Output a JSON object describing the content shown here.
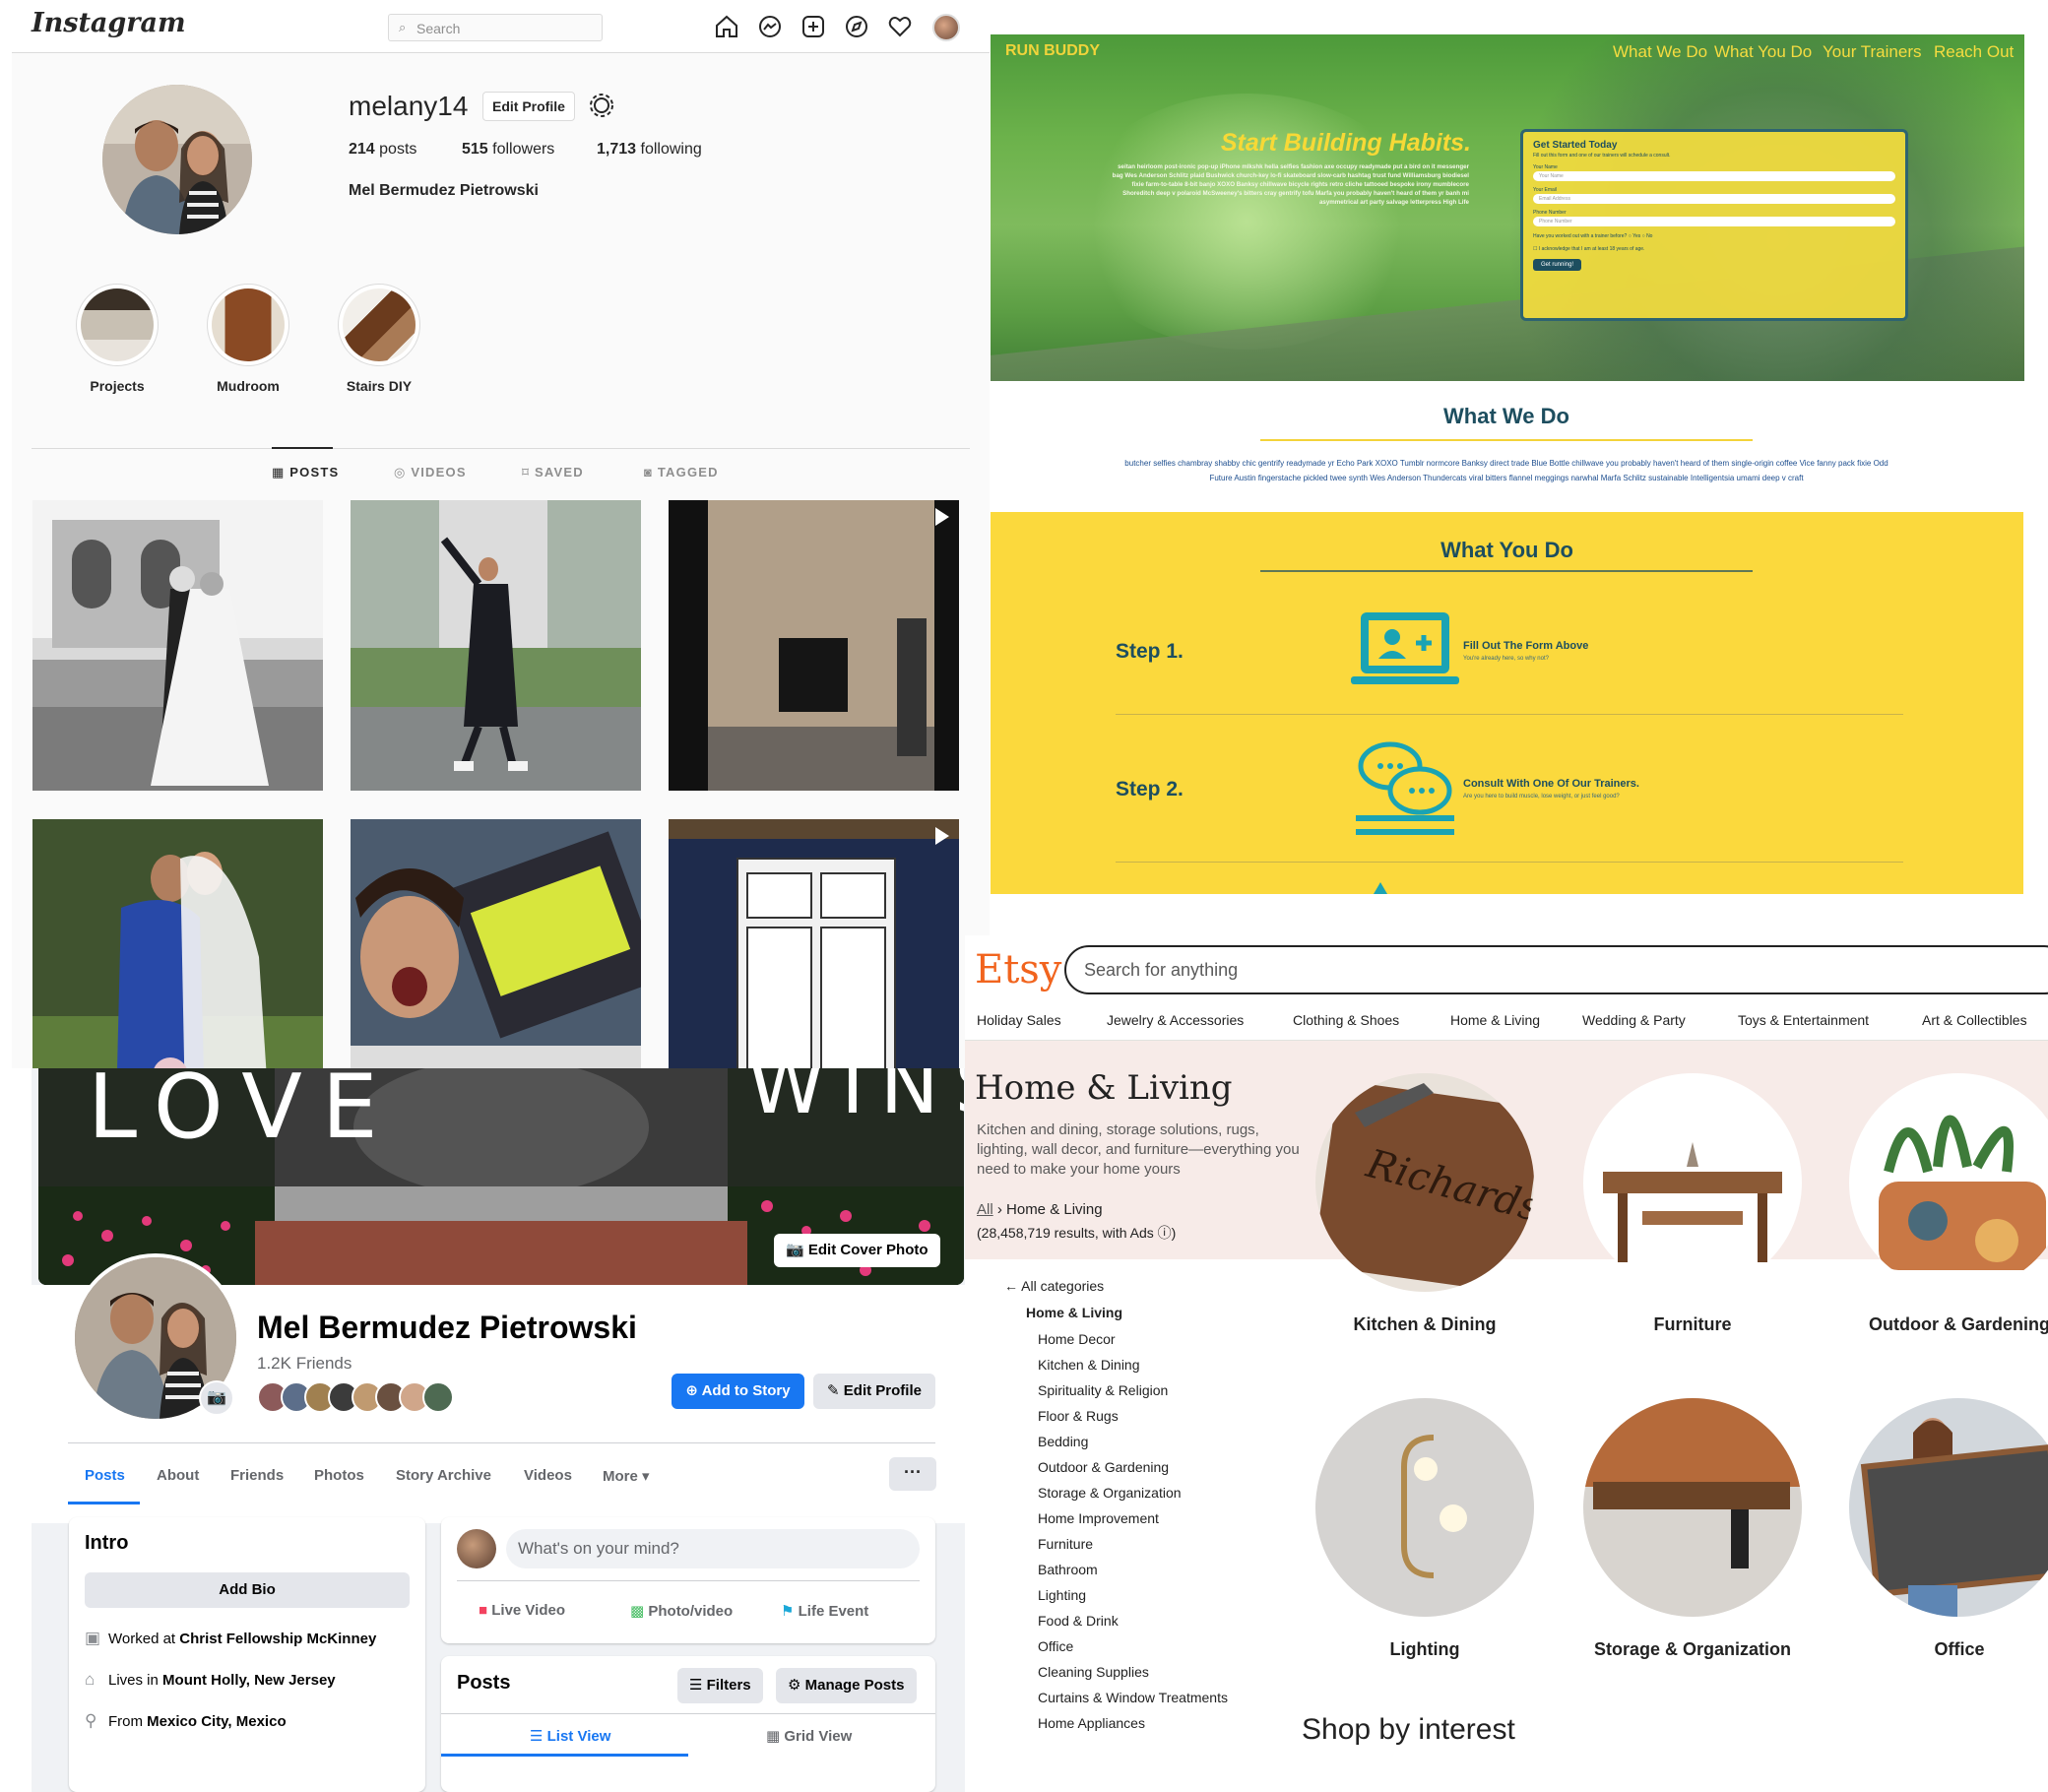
{
  "instagram": {
    "logo": "Instagram",
    "search_placeholder": "Search",
    "nav_icons": [
      "home-icon",
      "messenger-icon",
      "new-post-icon",
      "explore-icon",
      "heart-icon"
    ],
    "username": "melany14",
    "edit_profile": "Edit Profile",
    "stats": {
      "posts": "214",
      "posts_label": "posts",
      "followers": "515",
      "followers_label": "followers",
      "following": "1,713",
      "following_label": "following"
    },
    "full_name": "Mel Bermudez Pietrowski",
    "highlights": [
      "Projects",
      "Mudroom",
      "Stairs DIY"
    ],
    "tabs": [
      "POSTS",
      "VIDEOS",
      "SAVED",
      "TAGGED"
    ],
    "active_tab": "POSTS"
  },
  "runbuddy": {
    "brand": "RUN BUDDY",
    "nav": [
      "What We Do",
      "What You Do",
      "Your Trainers",
      "Reach Out"
    ],
    "headline": "Start Building Habits.",
    "hero_text": "seitan heirloom post-ironic pop-up iPhone mlkshk hella selfies fashion axe occupy readymade put a bird on it messenger bag Wes Anderson Schlitz plaid Bushwick church-key lo-fi skateboard slow-carb hashtag trust fund Williamsburg biodiesel fixie farm-to-table 8-bit banjo XOXO Banksy chillwave bicycle rights retro cliche tattooed bespoke irony mumblecore Shoreditch deep v polaroid McSweeney's bitters cray gentrify tofu Marfa you probably haven't heard of them yr banh mi asymmetrical art party salvage letterpress High Life",
    "form": {
      "title": "Get Started Today",
      "subtitle": "Fill out this form and one of our trainers will schedule a consult.",
      "fields": [
        {
          "label": "Your Name",
          "placeholder": "Your Name"
        },
        {
          "label": "Your Email",
          "placeholder": "Email Address"
        },
        {
          "label": "Phone Number",
          "placeholder": "Phone Number"
        }
      ],
      "question": "Have you worked out with a trainer before?",
      "yes": "Yes",
      "no": "No",
      "checkbox": "I acknowledge that I am at least 18 years of age.",
      "button": "Get running!"
    },
    "what_we_do_title": "What We Do",
    "what_we_do_text": "butcher selfies chambray shabby chic gentrify readymade yr Echo Park XOXO Tumblr normcore Banksy direct trade Blue Bottle chillwave you probably haven't heard of them single-origin coffee Vice fanny pack fixie Odd Future Austin fingerstache pickled twee synth Wes Anderson Thundercats viral bitters flannel meggings narwhal Marfa Schlitz sustainable Intelligentsia umami deep v craft",
    "what_you_do_title": "What You Do",
    "steps": [
      {
        "label": "Step 1.",
        "title": "Fill Out The Form Above",
        "sub": "You're already here, so why not?"
      },
      {
        "label": "Step 2.",
        "title": "Consult With One Of Our Trainers.",
        "sub": "Are you here to build muscle, lose weight, or just feel good?"
      }
    ],
    "colors": {
      "yellow": "#fbd93d",
      "navy": "#1d4e5f",
      "teal": "#1aa3b4"
    }
  },
  "facebook": {
    "cover_words_left": "LOVE",
    "cover_words_right": "WINS",
    "edit_cover": "Edit Cover Photo",
    "name": "Mel Bermudez Pietrowski",
    "friends": "1.2K Friends",
    "add_to_story": "Add to Story",
    "edit_profile": "Edit Profile",
    "tabs": [
      "Posts",
      "About",
      "Friends",
      "Photos",
      "Story Archive",
      "Videos",
      "More"
    ],
    "more_dots": "···",
    "intro_title": "Intro",
    "add_bio": "Add Bio",
    "intro_items": [
      {
        "icon": "briefcase-icon",
        "prefix": "Worked at ",
        "value": "Christ Fellowship McKinney"
      },
      {
        "icon": "home-icon",
        "prefix": "Lives in ",
        "value": "Mount Holly, New Jersey"
      },
      {
        "icon": "location-pin-icon",
        "prefix": "From ",
        "value": "Mexico City, Mexico"
      }
    ],
    "composer_placeholder": "What's on your mind?",
    "composer_buttons": [
      "Live Video",
      "Photo/video",
      "Life Event"
    ],
    "posts_title": "Posts",
    "filters": "Filters",
    "manage_posts": "Manage Posts",
    "list_view": "List View",
    "grid_view": "Grid View",
    "colors": {
      "blue": "#1877f2"
    }
  },
  "etsy": {
    "logo": "Etsy",
    "search_placeholder": "Search for anything",
    "categories": [
      "Holiday Sales",
      "Jewelry & Accessories",
      "Clothing & Shoes",
      "Home & Living",
      "Wedding & Party",
      "Toys & Entertainment",
      "Art & Collectibles"
    ],
    "title": "Home & Living",
    "description": "Kitchen and dining, storage solutions, rugs, lighting, wall decor, and furniture—everything you need to make your home yours",
    "breadcrumb_all": "All",
    "breadcrumb_current": "Home & Living",
    "results": "(28,458,719 results, with Ads ",
    "results_end": ")",
    "all_categories": "All categories",
    "sidebar_current": "Home & Living",
    "sidebar_items": [
      "Home Decor",
      "Kitchen & Dining",
      "Spirituality & Religion",
      "Floor & Rugs",
      "Bedding",
      "Outdoor & Gardening",
      "Storage & Organization",
      "Home Improvement",
      "Furniture",
      "Bathroom",
      "Lighting",
      "Food & Drink",
      "Office",
      "Cleaning Supplies",
      "Curtains & Window Treatments",
      "Home Appliances"
    ],
    "tiles": [
      "Kitchen & Dining",
      "Furniture",
      "Outdoor & Gardening",
      "Lighting",
      "Storage & Organization",
      "Office"
    ],
    "board_text": "Richards",
    "shop_by_interest": "Shop by interest",
    "colors": {
      "orange": "#f1641e",
      "band": "#f7ebe8"
    }
  }
}
